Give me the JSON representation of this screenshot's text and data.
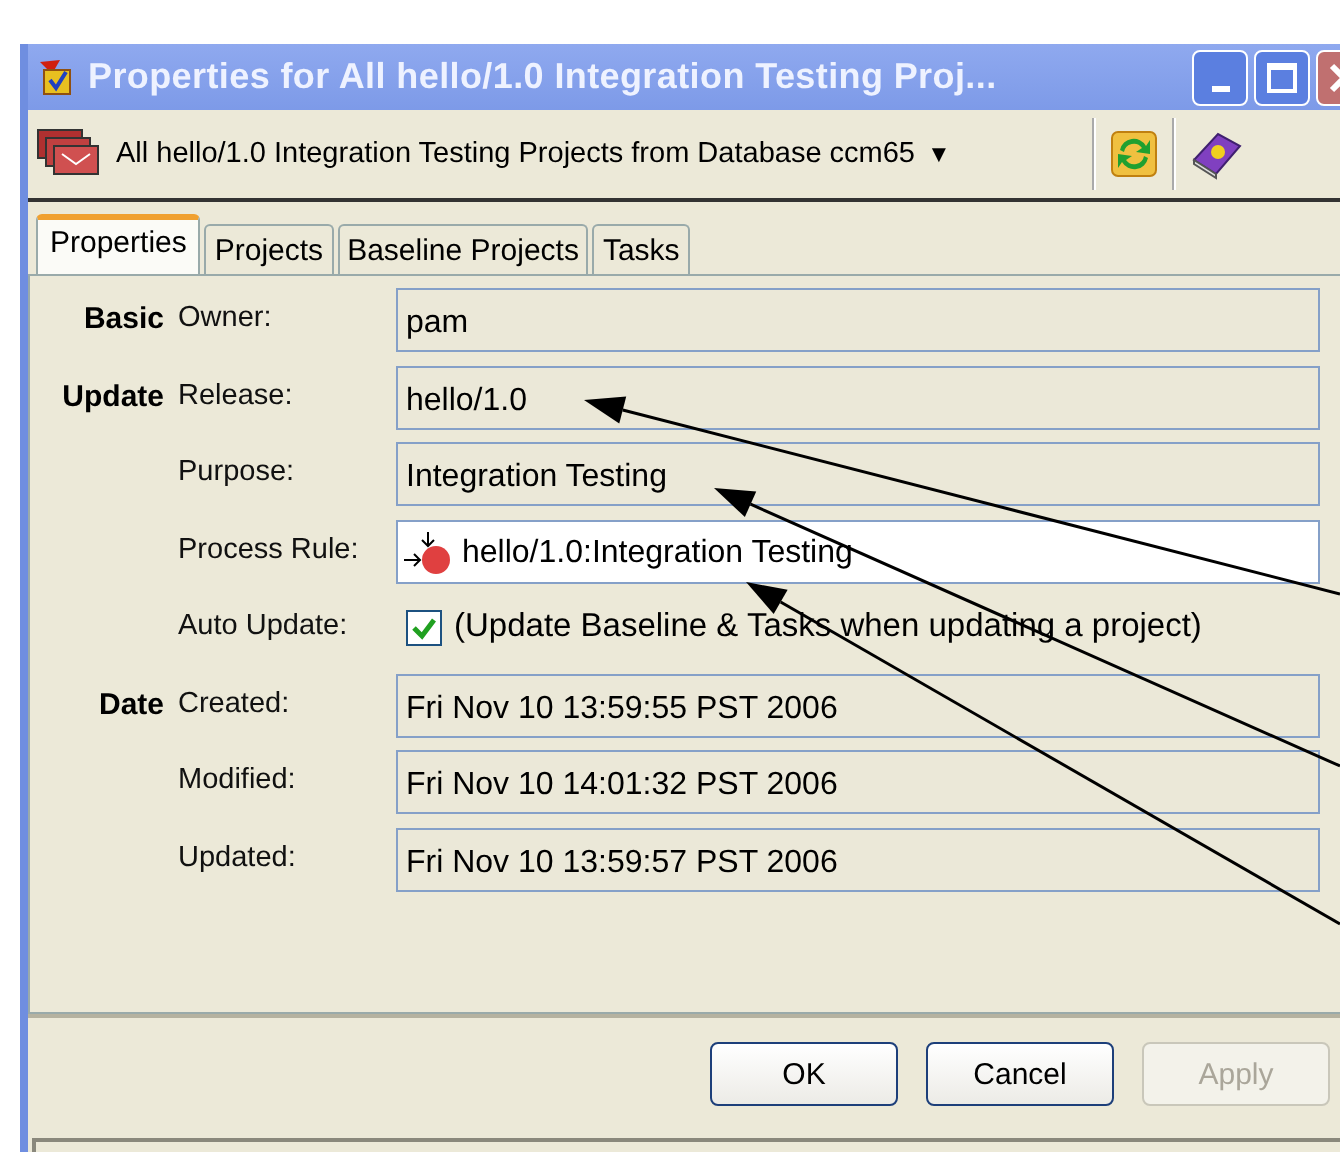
{
  "window": {
    "title": "Properties for All hello/1.0 Integration Testing Proj..."
  },
  "toolbar": {
    "query": "All hello/1.0 Integration Testing Projects from Database ccm65",
    "dropdown": "▼"
  },
  "tabs": [
    {
      "label": "Properties",
      "selected": true
    },
    {
      "label": "Projects",
      "selected": false
    },
    {
      "label": "Baseline Projects",
      "selected": false
    },
    {
      "label": "Tasks",
      "selected": false
    }
  ],
  "rows": [
    {
      "group": "Basic",
      "label": "Owner:",
      "kind": "field",
      "value": "pam"
    },
    {
      "group": "Update",
      "label": "Release:",
      "kind": "field",
      "value": "hello/1.0"
    },
    {
      "label": "Purpose:",
      "kind": "field",
      "value": "Integration Testing"
    },
    {
      "label": "Process Rule:",
      "kind": "rule",
      "value": "hello/1.0:Integration Testing"
    },
    {
      "label": "Auto Update:",
      "kind": "checkbox",
      "checked": true,
      "value": "(Update Baseline & Tasks when updating a project)"
    },
    {
      "group": "Date",
      "label": "Created:",
      "kind": "field",
      "value": "Fri Nov 10 13:59:55 PST 2006"
    },
    {
      "label": "Modified:",
      "kind": "field",
      "value": "Fri Nov 10 14:01:32 PST 2006"
    },
    {
      "label": "Updated:",
      "kind": "field",
      "value": "Fri Nov 10 13:59:57 PST 2006"
    }
  ],
  "buttons": [
    {
      "label": "OK",
      "disabled": false
    },
    {
      "label": "Cancel",
      "disabled": false
    },
    {
      "label": "Apply",
      "disabled": true
    }
  ]
}
